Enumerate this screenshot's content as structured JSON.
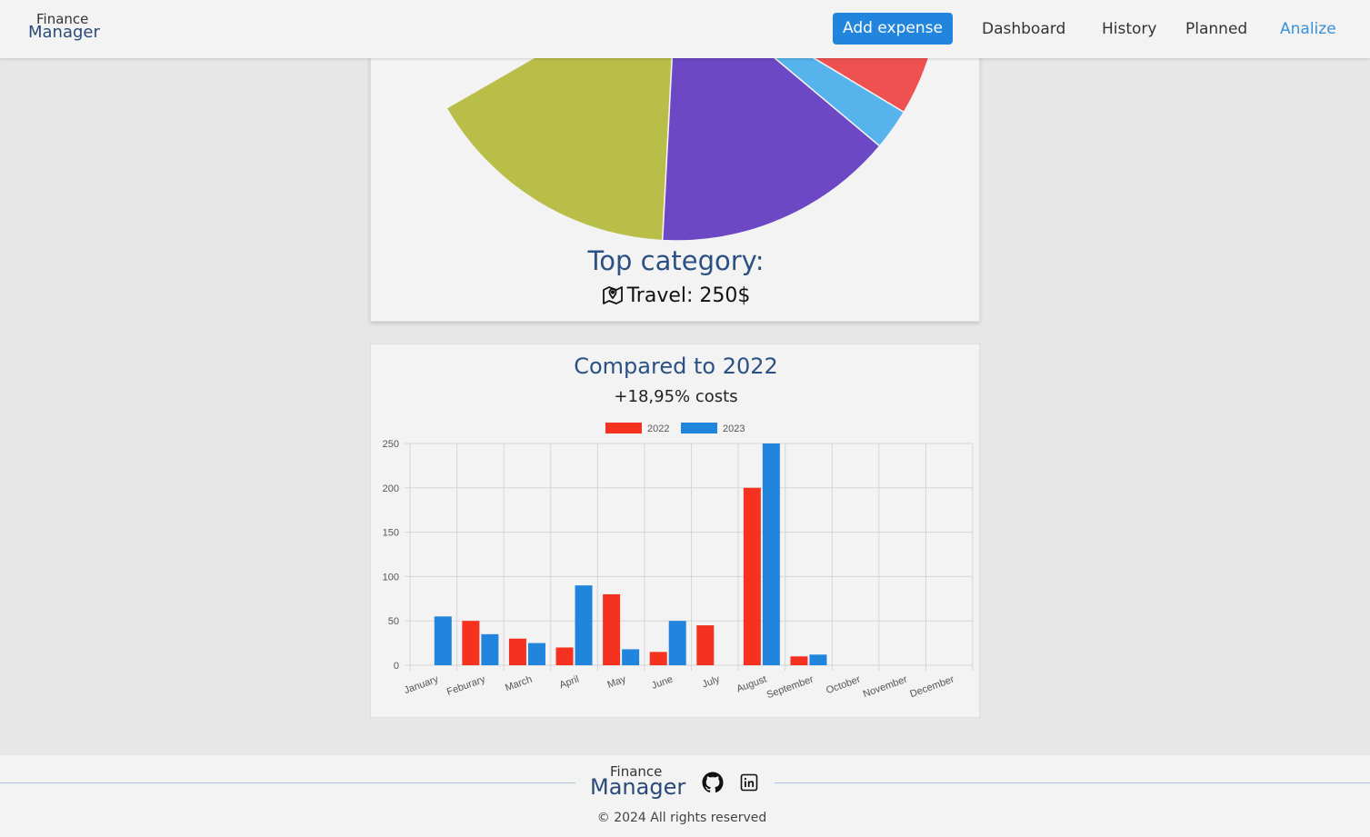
{
  "nav": {
    "brand_top": "Finance",
    "brand_bottom": "Manager",
    "add_expense": "Add expense",
    "links": [
      "Dashboard",
      "History",
      "Planned",
      "Analize"
    ],
    "active": "Analize"
  },
  "pie": {
    "slices": [
      {
        "color": "#b8be47"
      },
      {
        "color": "#6c48c5"
      },
      {
        "color": "#56b3ec"
      },
      {
        "color": "#ef5050"
      }
    ]
  },
  "top_category": {
    "title": "Top category:",
    "value": "Travel: 250$",
    "icon": "map-pin-icon"
  },
  "comparison": {
    "title": "Compared to 2022",
    "subtitle": "+18,95% costs"
  },
  "chart_data": {
    "type": "bar",
    "categories": [
      "January",
      "Feburary",
      "March",
      "April",
      "May",
      "June",
      "July",
      "August",
      "September",
      "October",
      "November",
      "December"
    ],
    "series": [
      {
        "name": "2022",
        "color": "#f53220",
        "values": [
          0,
          50,
          30,
          20,
          80,
          15,
          45,
          200,
          10,
          0,
          0,
          0
        ]
      },
      {
        "name": "2023",
        "color": "#2185de",
        "values": [
          55,
          35,
          25,
          90,
          18,
          50,
          0,
          250,
          12,
          0,
          0,
          0
        ]
      }
    ],
    "ylim": [
      0,
      250
    ],
    "yticks": [
      0,
      50,
      100,
      150,
      200,
      250
    ],
    "grid": true,
    "legend": "top-center"
  },
  "footer": {
    "brand_top": "Finance",
    "brand_bottom": "Manager",
    "copyright": "© 2024 All rights reserved",
    "icons": [
      "github-icon",
      "linkedin-icon"
    ]
  }
}
